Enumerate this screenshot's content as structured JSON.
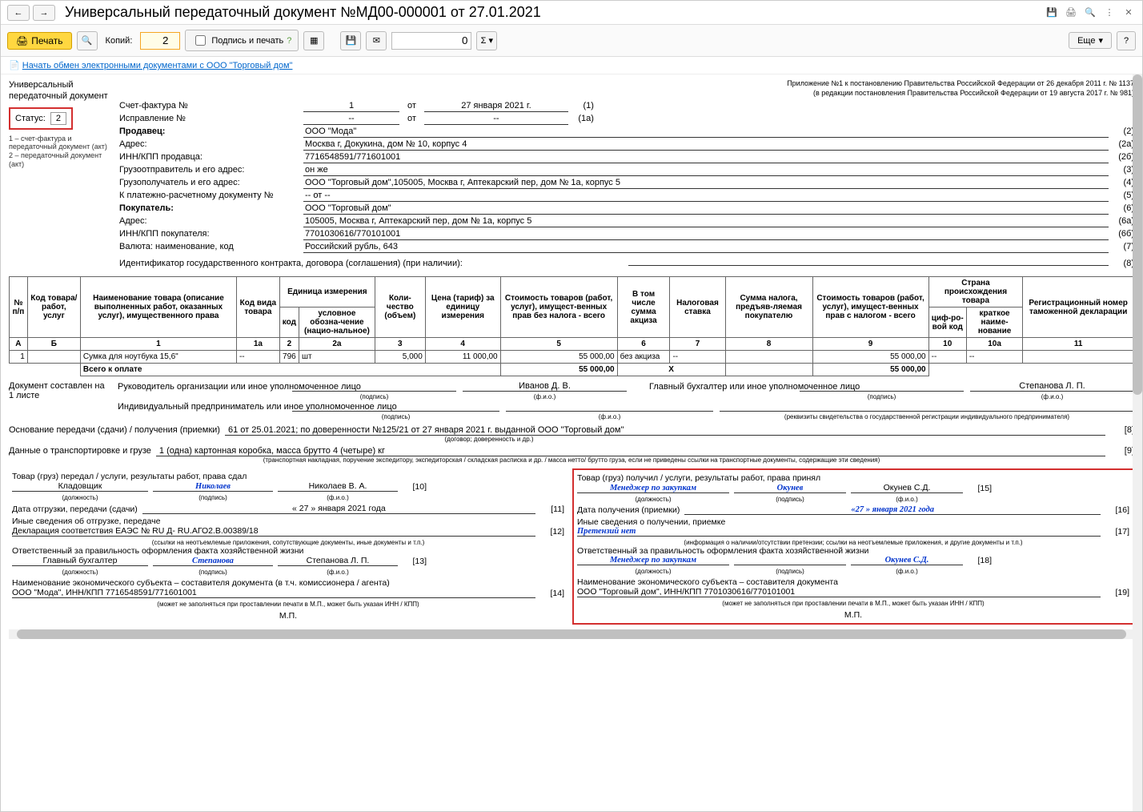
{
  "window": {
    "title": "Универсальный передаточный документ №МД00-000001 от 27.01.2021",
    "back": "←",
    "fwd": "→"
  },
  "toolbar": {
    "print": "Печать",
    "copies_label": "Копий:",
    "copies": "2",
    "sign_print": "Подпись и печать",
    "qty": "0",
    "more": "Еще"
  },
  "linkbar": {
    "edi": "Начать обмен электронными документами с ООО \"Торговый дом\""
  },
  "sidebar": {
    "title": "Универсальный передаточный документ",
    "status_label": "Статус:",
    "status": "2",
    "note1": "1 – счет-фактура и передаточный документ (акт)",
    "note2": "2 – передаточный документ (акт)"
  },
  "appendix": {
    "l1": "Приложение №1 к постановлению Правительства Российской Федерации от 26 декабря 2011 г. № 1137",
    "l2": "(в редакции постановления Правительства Российской Федерации от 19 августа 2017 г. № 981)"
  },
  "header": {
    "invoice_lbl": "Счет-фактура №",
    "invoice_no": "1",
    "from": "от",
    "invoice_date": "27 января 2021 г.",
    "n1": "(1)",
    "corr_lbl": "Исправление №",
    "corr_no": "--",
    "corr_date": "--",
    "n1a": "(1а)",
    "seller_lbl": "Продавец:",
    "seller": "ООО \"Мода\"",
    "n2": "(2)",
    "addr_lbl": "Адрес:",
    "addr": "Москва г, Докукина, дом № 10, корпус 4",
    "n2a": "(2а)",
    "inn_lbl": "ИНН/КПП продавца:",
    "inn": "7716548591/771601001",
    "n2b": "(2б)",
    "shipper_lbl": "Грузоотправитель и его адрес:",
    "shipper": "он же",
    "n3": "(3)",
    "consignee_lbl": "Грузополучатель и его адрес:",
    "consignee": "ООО \"Торговый дом\",105005, Москва г, Аптекарский пер, дом № 1а, корпус 5",
    "n4": "(4)",
    "paydoc_lbl": "К платежно-расчетному документу №",
    "paydoc": "-- от --",
    "n5": "(5)",
    "buyer_lbl": "Покупатель:",
    "buyer": "ООО \"Торговый дом\"",
    "n6": "(6)",
    "baddr_lbl": "Адрес:",
    "baddr": "105005, Москва г, Аптекарский пер, дом № 1а, корпус 5",
    "n6a": "(6а)",
    "binn_lbl": "ИНН/КПП покупателя:",
    "binn": "7701030616/770101001",
    "n6b": "(6б)",
    "curr_lbl": "Валюта: наименование, код",
    "curr": "Российский рубль, 643",
    "n7": "(7)",
    "contract_lbl": "Идентификатор государственного контракта, договора (соглашения) (при наличии):",
    "n8": "(8)"
  },
  "th": {
    "c0": "№ п/п",
    "c1": "Код товара/ работ, услуг",
    "c2": "Наименование товара (описание выполненных работ, оказанных услуг), имущественного права",
    "c3": "Код вида товара",
    "unit": "Единица измерения",
    "c4a": "код",
    "c4b": "условное обозна-чение (нацио-нальное)",
    "c5": "Коли-чество (объем)",
    "c6": "Цена (тариф) за единицу измерения",
    "c7": "Стоимость товаров (работ, услуг), имущест-венных прав без налога - всего",
    "c8": "В том числе сумма акциза",
    "c9": "Налоговая ставка",
    "c10": "Сумма налога, предъяв-ляемая покупателю",
    "c11": "Стоимость товаров (работ, услуг), имущест-венных прав с налогом - всего",
    "country": "Страна происхождения товара",
    "c12a": "циф-ро-вой код",
    "c12b": "краткое наиме-нование",
    "c13": "Регистрационный номер таможенной декларации"
  },
  "tn": {
    "c0": "А",
    "c1": "Б",
    "c2": "1",
    "c3": "1а",
    "c4a": "2",
    "c4b": "2а",
    "c5": "3",
    "c6": "4",
    "c7": "5",
    "c8": "6",
    "c9": "7",
    "c10": "8",
    "c11": "9",
    "c12a": "10",
    "c12b": "10а",
    "c13": "11"
  },
  "row": {
    "n": "1",
    "code": "",
    "name": "Сумка для ноутбука 15,6\"",
    "kind": "--",
    "ucode": "796",
    "uname": "шт",
    "qty": "5,000",
    "price": "11 000,00",
    "sum": "55 000,00",
    "excise": "без акциза",
    "rate": "--",
    "tax": "",
    "total": "55 000,00",
    "cc": "--",
    "cn": "--",
    "decl": ""
  },
  "total": {
    "lbl": "Всего к оплате",
    "sum": "55 000,00",
    "x": "X",
    "total": "55 000,00"
  },
  "sig": {
    "doc_on": "Документ составлен на 1 листе",
    "head": "Руководитель организации или иное уполномоченное лицо",
    "head_fio": "Иванов Д. В.",
    "acc": "Главный бухгалтер или иное уполномоченное лицо",
    "acc_fio": "Степанова Л. П.",
    "ip": "Индивидуальный предприниматель или иное уполномоченное лицо",
    "sign": "(подпись)",
    "fio": "(ф.и.о.)",
    "ip_note": "(реквизиты свидетельства о государственной  регистрации индивидуального предпринимателя)",
    "basis_lbl": "Основание передачи (сдачи) / получения (приемки)",
    "basis": "61 от 25.01.2021; по доверенности №125/21 от 27 января 2021 г. выданной ООО \"Торговый дом\"",
    "basis_cap": "(договор; доверенность и др.)",
    "basis_n": "[8]",
    "trans_lbl": "Данные о транспортировке и грузе",
    "trans": "1 (одна) картонная коробка, масса брутто 4 (четыре) кг",
    "trans_cap": "(транспортная накладная, поручение экспедитору, экспедиторская / складская расписка и др. / масса нетто/ брутто груза, если не приведены ссылки на транспортные документы, содержащие эти сведения)",
    "trans_n": "[9]"
  },
  "left": {
    "h": "Товар (груз) передал / услуги, результаты работ, права сдал",
    "pos": "Кладовщик",
    "sign": "Николаев",
    "fio": "Николаев В. А.",
    "n10": "[10]",
    "date_lbl": "Дата отгрузки, передачи (сдачи)",
    "date": "« 27 »   января   2021  года",
    "n11": "[11]",
    "other_lbl": "Иные сведения об отгрузке, передаче",
    "other": "Декларация соответствия ЕАЭС № RU Д- RU.АГО2.В.00389/18",
    "n12": "[12]",
    "other_cap": "(ссылки на неотъемлемые приложения, сопутствующие документы, иные документы и т.п.)",
    "resp_lbl": "Ответственный за правильность оформления факта хозяйственной жизни",
    "resp_pos": "Главный бухгалтер",
    "resp_sign": "Степанова",
    "resp_fio": "Степанова Л. П.",
    "n13": "[13]",
    "org_lbl": "Наименование экономического субъекта – составителя документа (в т.ч. комиссионера / агента)",
    "org": "ООО \"Мода\", ИНН/КПП 7716548591/771601001",
    "n14": "[14]",
    "org_cap": "(может не заполняться при проставлении печати в М.П., может быть указан ИНН / КПП)",
    "mp": "М.П.",
    "pos_cap": "(должность)"
  },
  "right": {
    "h": "Товар (груз) получил / услуги, результаты работ, права принял",
    "pos": "Менеджер по закупкам",
    "sign": "Окунев",
    "fio": "Окунев С.Д.",
    "n15": "[15]",
    "date_lbl": "Дата получения (приемки)",
    "date": "«27 »  января   2021 года",
    "n16": "[16]",
    "other_lbl": "Иные сведения о получении, приемке",
    "other": "Претензий нет",
    "n17": "[17]",
    "other_cap": "(информация о наличии/отсутствии претензии; ссылки на неотъемлемые приложения, и другие  документы и т.п.)",
    "resp_lbl": "Ответственный за правильность оформления факта хозяйственной жизни",
    "resp_pos": "Менеджер по закупкам",
    "resp_sign": "",
    "resp_fio": "Окунев С.Д.",
    "n18": "[18]",
    "org_lbl": "Наименование экономического субъекта – составителя документа",
    "org": "ООО \"Торговый дом\", ИНН/КПП 7701030616/770101001",
    "n19": "[19]",
    "org_cap": "(может не заполняться при проставлении печати в М.П., может быть указан ИНН / КПП)",
    "mp": "М.П.",
    "pos_cap": "(должность)"
  }
}
